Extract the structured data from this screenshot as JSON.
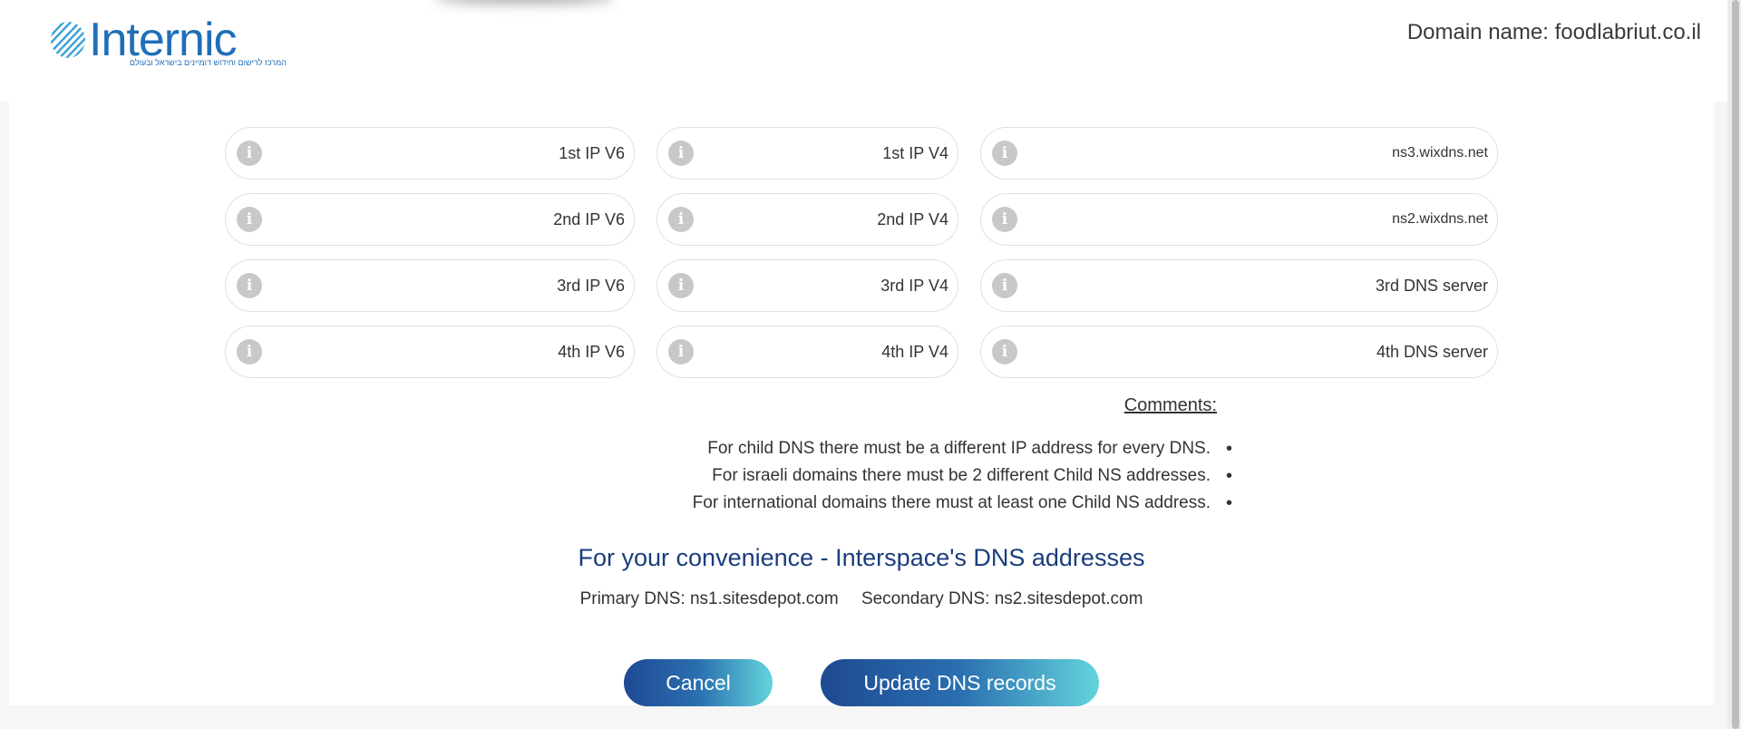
{
  "header": {
    "logo_text": "Internic",
    "logo_tagline": "המרכז לרישום וחידוש דומיינים בישראל ובעולם",
    "domain_label": "Domain name: foodlabriut.co.il"
  },
  "fields": {
    "ipv6": [
      "1st IP V6",
      "2nd IP V6",
      "3rd IP V6",
      "4th IP V6"
    ],
    "ipv4": [
      "1st IP V4",
      "2nd IP V4",
      "3rd IP V4",
      "4th IP V4"
    ],
    "dns": [
      "ns3.wixdns.net",
      "ns2.wixdns.net",
      "3rd DNS server",
      "4th DNS server"
    ]
  },
  "comments": {
    "title": ":Comments",
    "items": [
      ".For child DNS there must be a different IP address for every DNS",
      ".For israeli domains there must be 2 different Child NS addresses",
      ".For international domains there must at least one Child NS address"
    ]
  },
  "convenience": {
    "title": "For your convenience - Interspace's DNS addresses",
    "primary": "Primary DNS: ns1.sitesdepot.com",
    "secondary": "Secondary DNS: ns2.sitesdepot.com"
  },
  "buttons": {
    "cancel": "Cancel",
    "update": "Update DNS records"
  },
  "colors": {
    "brand": "#1f6fb8",
    "heading": "#1a3d7c",
    "button_start": "#1e4a92",
    "button_end": "#63d4dc"
  },
  "icons": {
    "info": "info-icon",
    "logo_mark": "internic-logo-icon"
  }
}
